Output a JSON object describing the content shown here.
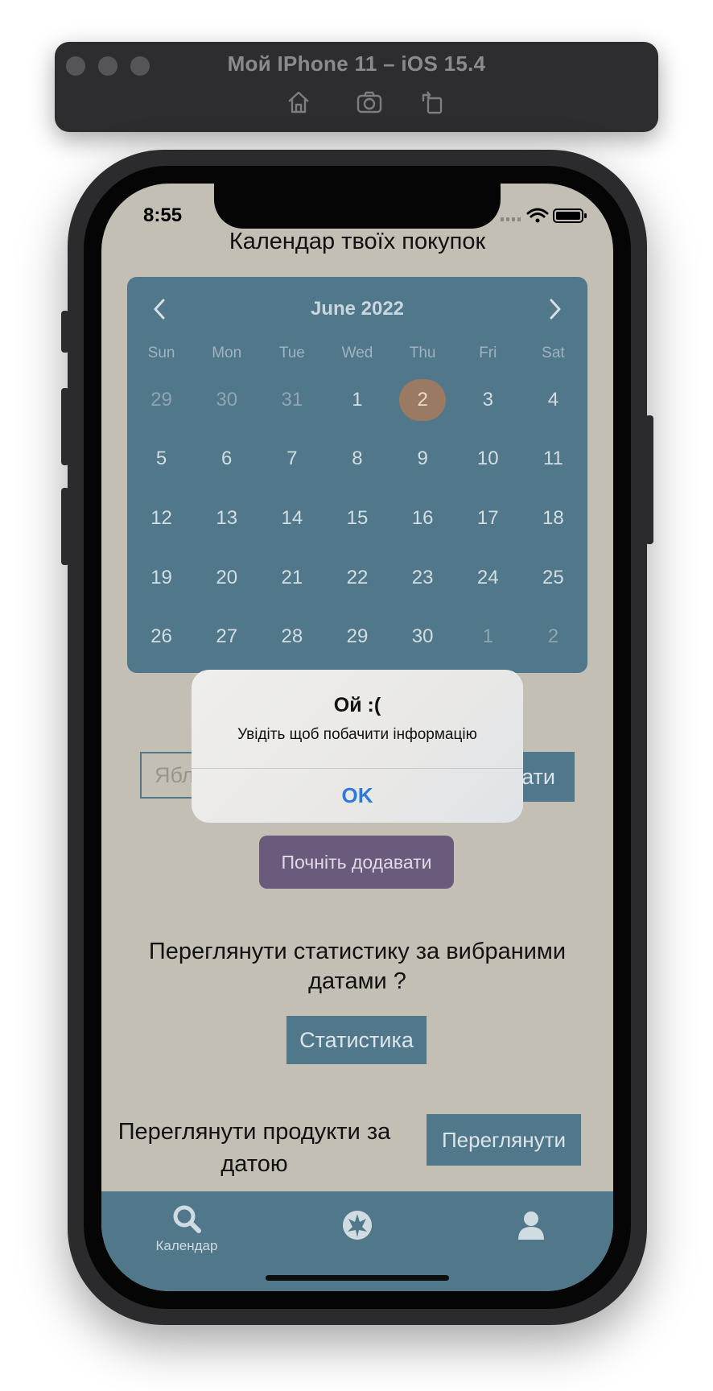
{
  "simulator": {
    "title": "Мой IPhone 11 – iOS 15.4",
    "tools": [
      "home-icon",
      "screenshot-icon",
      "rotate-icon"
    ]
  },
  "status_bar": {
    "time": "8:55"
  },
  "screen_title": "Календар твоїх покупок",
  "calendar": {
    "month_label": "June 2022",
    "weekdays": [
      "Sun",
      "Mon",
      "Tue",
      "Wed",
      "Thu",
      "Fri",
      "Sat"
    ],
    "weeks": [
      [
        {
          "d": "29",
          "other": true
        },
        {
          "d": "30",
          "other": true
        },
        {
          "d": "31",
          "other": true
        },
        {
          "d": "1"
        },
        {
          "d": "2",
          "selected": true
        },
        {
          "d": "3"
        },
        {
          "d": "4"
        }
      ],
      [
        {
          "d": "5"
        },
        {
          "d": "6"
        },
        {
          "d": "7"
        },
        {
          "d": "8"
        },
        {
          "d": "9"
        },
        {
          "d": "10"
        },
        {
          "d": "11"
        }
      ],
      [
        {
          "d": "12"
        },
        {
          "d": "13"
        },
        {
          "d": "14"
        },
        {
          "d": "15"
        },
        {
          "d": "16"
        },
        {
          "d": "17"
        },
        {
          "d": "18"
        }
      ],
      [
        {
          "d": "19"
        },
        {
          "d": "20"
        },
        {
          "d": "21"
        },
        {
          "d": "22"
        },
        {
          "d": "23"
        },
        {
          "d": "24"
        },
        {
          "d": "25"
        }
      ],
      [
        {
          "d": "26"
        },
        {
          "d": "27"
        },
        {
          "d": "28"
        },
        {
          "d": "29"
        },
        {
          "d": "30"
        },
        {
          "d": "1",
          "other": true
        },
        {
          "d": "2",
          "other": true
        }
      ]
    ],
    "selected_color": "#9a7a62"
  },
  "input_row": {
    "input_value": "Ябл",
    "button_visible_text": "ати"
  },
  "start_button": "Почніть додавати",
  "stats": {
    "text": "Переглянути статистику за вибраними датами ?",
    "button": "Статистика"
  },
  "products": {
    "text": "Переглянути продукти за датою",
    "button": "Переглянути"
  },
  "tabbar": {
    "tabs": [
      {
        "icon": "search-icon",
        "label": "Календар"
      },
      {
        "icon": "rebel-emblem-icon",
        "label": ""
      },
      {
        "icon": "user-icon",
        "label": ""
      }
    ]
  },
  "alert": {
    "title": "Ой :(",
    "message": "Увідіть щоб побачити інформацію",
    "ok": "OK"
  },
  "colors": {
    "screen_bg": "#c4bfb4",
    "accent": "#50778a",
    "start_button": "#6a5a7c",
    "alert_ok": "#2d7ad9"
  }
}
